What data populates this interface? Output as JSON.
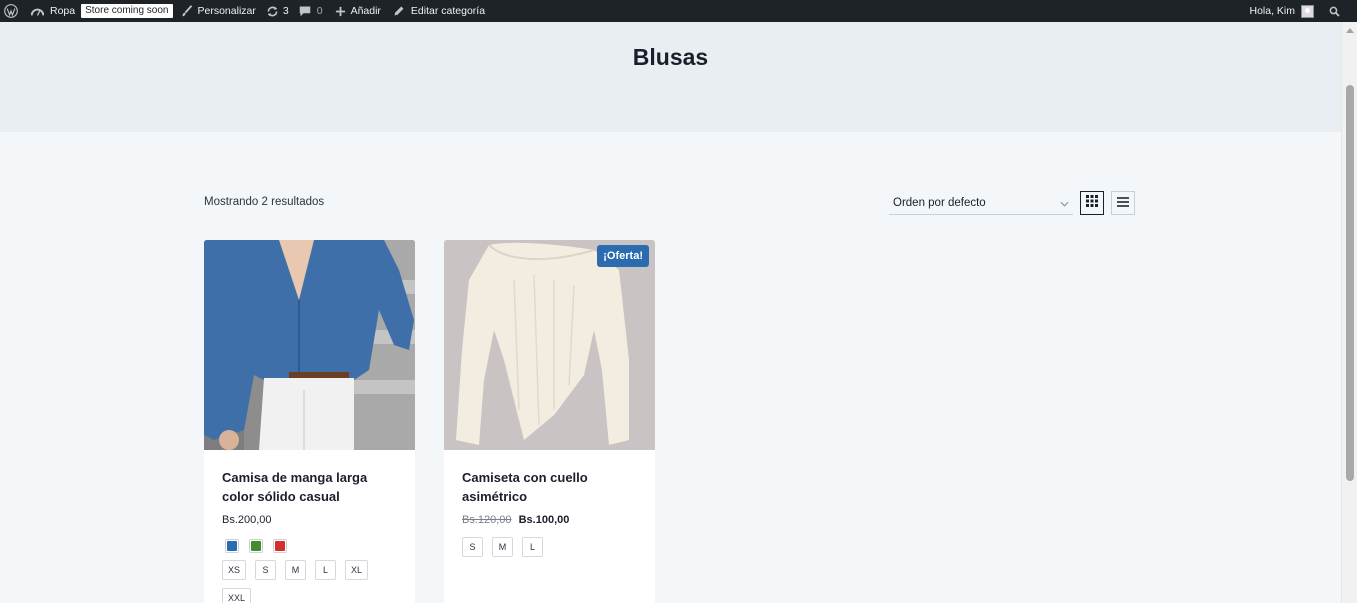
{
  "adminbar": {
    "site_name": "Ropa",
    "store_badge": "Store coming soon",
    "customize": "Personalizar",
    "updates_count": "3",
    "comments_count": "0",
    "add_new": "Añadir",
    "edit_category": "Editar categoría",
    "greeting": "Hola, Kim"
  },
  "page": {
    "title": "Blusas"
  },
  "toolbar": {
    "result_count": "Mostrando 2 resultados",
    "orderby_selected": "Orden por defecto"
  },
  "products": [
    {
      "title": "Camisa de manga larga color sólido casual",
      "price": "Bs.200,00",
      "colors": [
        "#2b6cb0",
        "#3e8e2d",
        "#d32f2f"
      ],
      "sizes": [
        "XS",
        "S",
        "M",
        "L",
        "XL",
        "XXL"
      ]
    },
    {
      "title": "Camiseta con cuello asimétrico",
      "badge": "¡Oferta!",
      "regular_price": "Bs.120,00",
      "sale_price": "Bs.100,00",
      "sizes": [
        "S",
        "M",
        "L"
      ]
    }
  ]
}
